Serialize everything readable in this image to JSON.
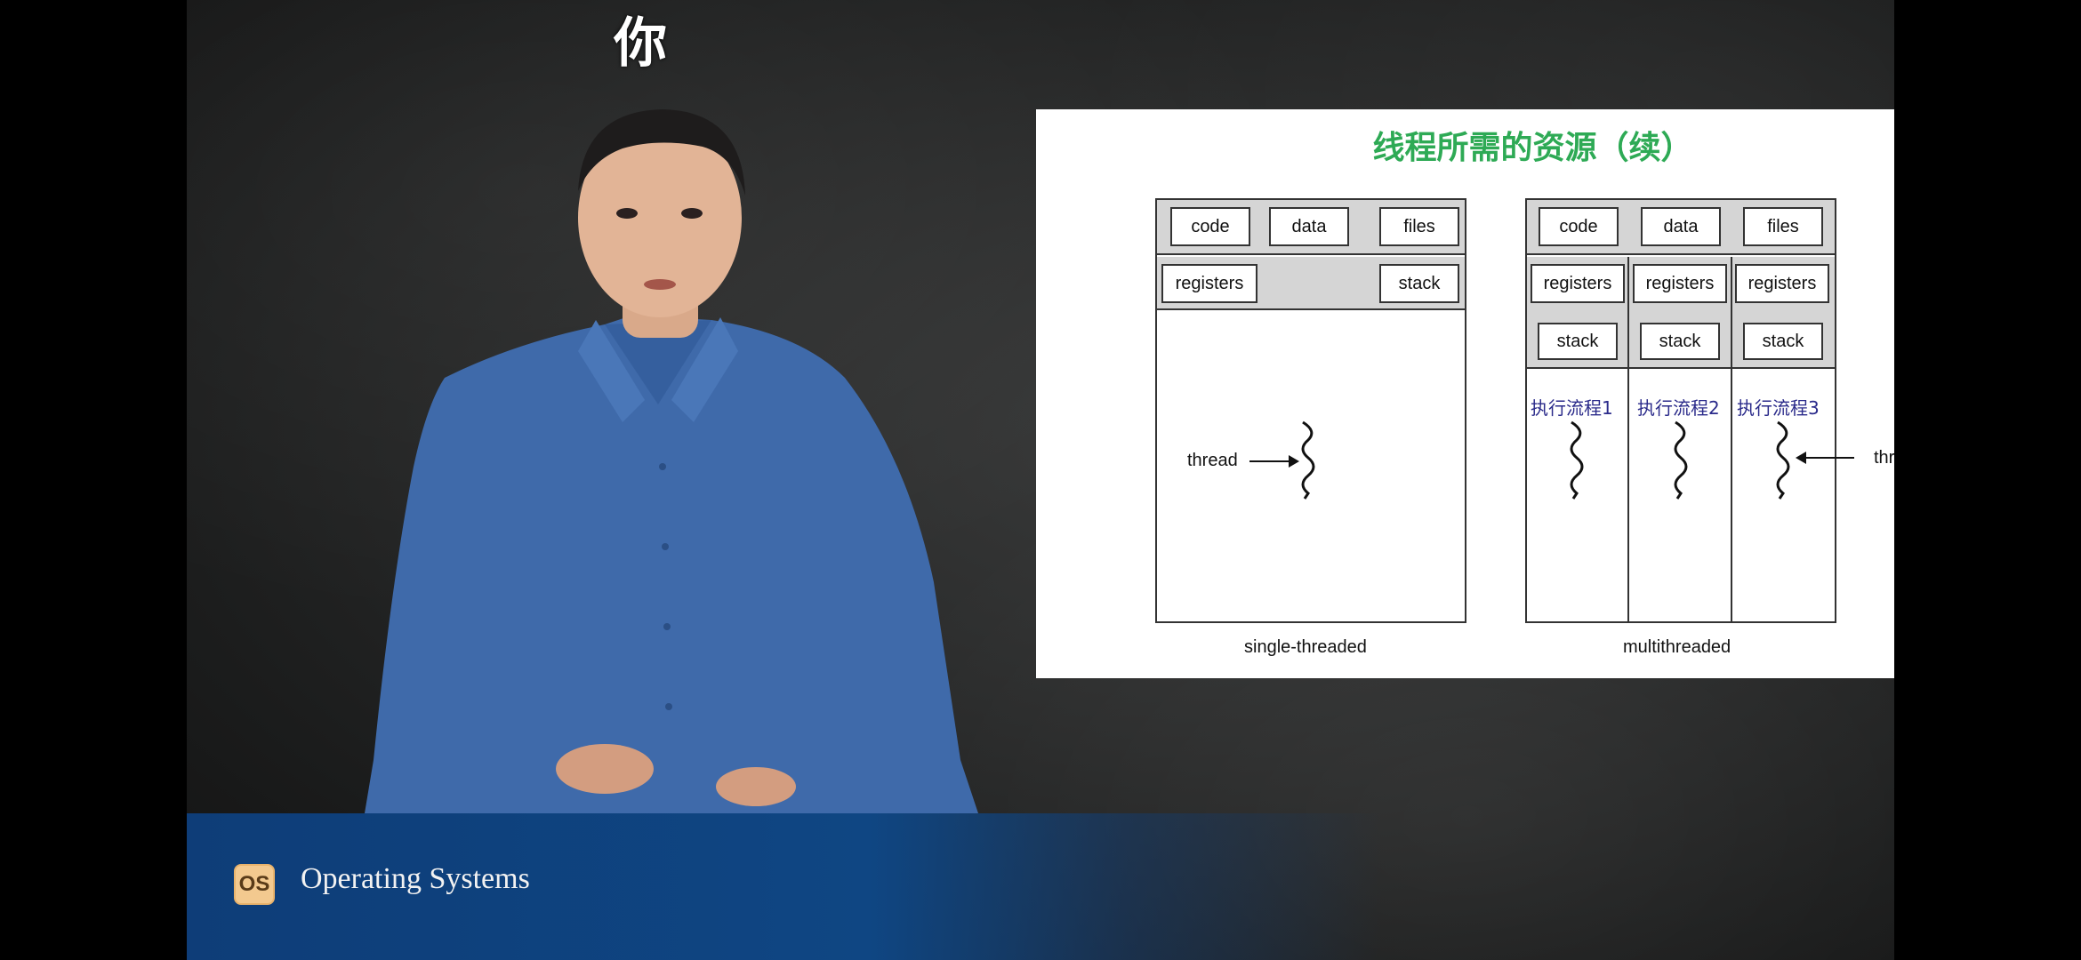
{
  "caption": {
    "char": "你"
  },
  "slide": {
    "title": "线程所需的资源（续）",
    "single": {
      "code": "code",
      "data": "data",
      "files": "files",
      "registers": "registers",
      "stack": "stack",
      "thread_label": "thread",
      "caption": "single-threaded"
    },
    "multi": {
      "code": "code",
      "data": "data",
      "files": "files",
      "registers": [
        "registers",
        "registers",
        "registers"
      ],
      "stacks": [
        "stack",
        "stack",
        "stack"
      ],
      "flows": [
        "执行流程1",
        "执行流程2",
        "执行流程3"
      ],
      "thread_label": "thread",
      "caption": "multithreaded"
    }
  },
  "branding": {
    "logo_text": "OS",
    "title": "Operating Systems"
  },
  "colors": {
    "slide_title": "#2eaa55",
    "flow_labels": "#2a2a8a",
    "lower_third": "#0f4683",
    "logo_bg": "#f3c98f"
  }
}
